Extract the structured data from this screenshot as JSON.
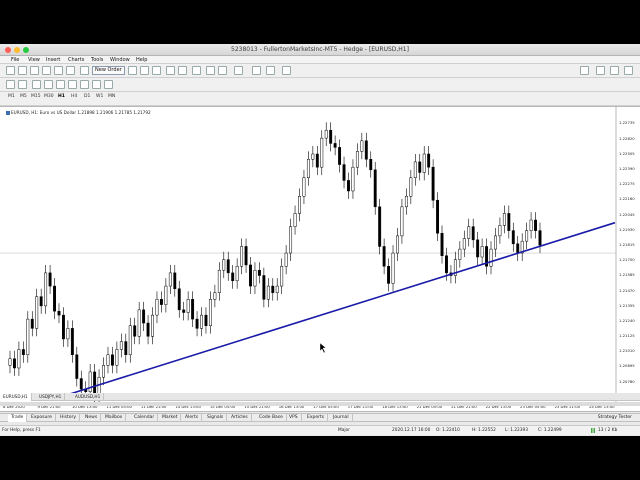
{
  "window": {
    "title": "5238013 - FullertonMarketsInc-MT5 - Hedge - [EURUSD,H1]"
  },
  "menu": [
    "File",
    "View",
    "Insert",
    "Charts",
    "Tools",
    "Window",
    "Help"
  ],
  "toolbar": {
    "new_order_label": "New Order",
    "timeframes": [
      "M1",
      "M5",
      "M15",
      "M30",
      "H1",
      "H4",
      "D1",
      "W1",
      "MN"
    ],
    "active_timeframe": "H1"
  },
  "chart": {
    "info_label": "EURUSD, H1:  Euro vs US Dollar  1.21898  1.21906  1.21785  1.21792",
    "background_color": "#ffffff",
    "candle_color": "#000000",
    "trendline_color": "#1a1aa8"
  },
  "chart_data": {
    "type": "candlestick",
    "symbol": "EURUSD",
    "timeframe": "H1",
    "y_axis_ticks": [
      "1.22735",
      "1.22620",
      "1.22505",
      "1.22390",
      "1.22275",
      "1.22160",
      "1.22045",
      "1.21930",
      "1.21815",
      "1.21700",
      "1.21585",
      "1.21470",
      "1.21355",
      "1.21240",
      "1.21125",
      "1.21010",
      "1.20895",
      "1.20780",
      "1.20665"
    ],
    "x_axis_ticks": [
      "8 Dec 2020",
      "9 Dec 21:00",
      "10 Dec 13:00",
      "11 Dec 05:00",
      "11 Dec 21:00",
      "14 Dec 13:00",
      "15 Dec 05:00",
      "15 Dec 21:00",
      "16 Dec 13:00",
      "17 Dec 05:00",
      "17 Dec 21:00",
      "18 Dec 13:00",
      "21 Dec 05:00",
      "21 Dec 21:00",
      "22 Dec 13:00",
      "23 Dec 05:00",
      "23 Dec 21:00",
      "24 Dec 13:00"
    ],
    "ylim": [
      1.2063,
      1.2278
    ],
    "horizontal_line": 1.2175,
    "trendline": {
      "from_index": 0,
      "from_price": 1.2065,
      "to_index": 17.6,
      "to_price": 1.2198
    },
    "closes": [
      1.2095,
      1.2088,
      1.2102,
      1.2098,
      1.2125,
      1.2118,
      1.2142,
      1.2135,
      1.216,
      1.215,
      1.2131,
      1.2128,
      1.211,
      1.2118,
      1.2098,
      1.208,
      1.2072,
      1.207,
      1.2085,
      1.2068,
      1.2081,
      1.209,
      1.2098,
      1.209,
      1.2102,
      1.2108,
      1.2098,
      1.212,
      1.2112,
      1.2132,
      1.2122,
      1.2112,
      1.2128,
      1.214,
      1.2136,
      1.215,
      1.216,
      1.2148,
      1.2132,
      1.213,
      1.214,
      1.2125,
      1.2118,
      1.2128,
      1.212,
      1.214,
      1.2145,
      1.2162,
      1.217,
      1.216,
      1.2154,
      1.2165,
      1.218,
      1.2166,
      1.215,
      1.2162,
      1.2158,
      1.214,
      1.215,
      1.2145,
      1.215,
      1.2165,
      1.2175,
      1.2195,
      1.2205,
      1.2218,
      1.2232,
      1.2246,
      1.225,
      1.224,
      1.2262,
      1.2268,
      1.2258,
      1.2255,
      1.2242,
      1.223,
      1.2222,
      1.224,
      1.2252,
      1.226,
      1.2246,
      1.2238,
      1.221,
      1.218,
      1.2165,
      1.2152,
      1.2175,
      1.2188,
      1.221,
      1.2218,
      1.2232,
      1.2244,
      1.2236,
      1.225,
      1.224,
      1.2215,
      1.219,
      1.2173,
      1.216,
      1.2158,
      1.217,
      1.2178,
      1.2186,
      1.2195,
      1.2185,
      1.2172,
      1.218,
      1.2165,
      1.2178,
      1.2188,
      1.2196,
      1.2205,
      1.2192,
      1.2182,
      1.2175,
      1.2184,
      1.2192,
      1.22,
      1.2192,
      1.2181
    ]
  },
  "chart_tabs": [
    "EURUSD,H1",
    "USDJPY,H1",
    "AUDUSD,H1"
  ],
  "active_chart_tab": "EURUSD,H1",
  "terminal_tabs": [
    "Trade",
    "Exposure",
    "History",
    "News",
    "Mailbox",
    "Calendar",
    "Market",
    "Alerts",
    "Signals",
    "Articles",
    "Code Base",
    "VPS",
    "Experts",
    "Journal"
  ],
  "active_terminal_tab": "Trade",
  "strategy_tester_label": "Strategy Tester",
  "status": {
    "help": "For Help, press F1",
    "profile": "Major",
    "datetime": "2020.12.17 16:00",
    "open": "O: 1.22410",
    "high": "H: 1.22552",
    "low": "L: 1.22393",
    "close": "C: 1.22499",
    "traffic": "13 / 2 Kb"
  }
}
